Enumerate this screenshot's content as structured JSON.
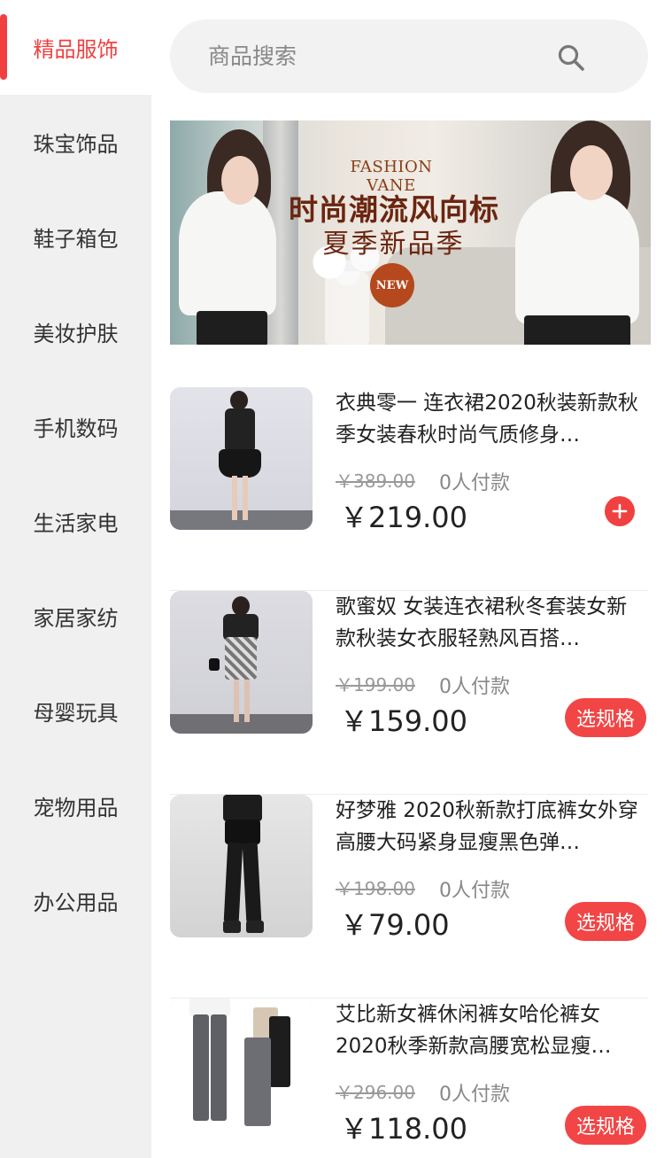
{
  "sidebar": {
    "categories": [
      {
        "label": "精品服饰",
        "active": true
      },
      {
        "label": "珠宝饰品",
        "active": false
      },
      {
        "label": "鞋子箱包",
        "active": false
      },
      {
        "label": "美妆护肤",
        "active": false
      },
      {
        "label": "手机数码",
        "active": false
      },
      {
        "label": "生活家电",
        "active": false
      },
      {
        "label": "家居家纺",
        "active": false
      },
      {
        "label": "母婴玩具",
        "active": false
      },
      {
        "label": "宠物用品",
        "active": false
      },
      {
        "label": "办公用品",
        "active": false
      }
    ],
    "active_color": "#f04040"
  },
  "search": {
    "placeholder": "商品搜索",
    "icon": "search-icon"
  },
  "banner": {
    "brand": "FASHION VANE",
    "headline": "时尚潮流风向标",
    "subtitle": "夏季新品季",
    "badge": "NEW"
  },
  "products": [
    {
      "title": "衣典零一 连衣裙2020秋装新款秋季女装春秋时尚气质修身…",
      "original_price": "￥389.00",
      "paid_count": "0人付款",
      "price": "￥219.00",
      "action": "add",
      "action_icon": "plus-icon"
    },
    {
      "title": "歌蜜奴 女装连衣裙秋冬套装女新款秋装女衣服轻熟风百搭…",
      "original_price": "￥199.00",
      "paid_count": "0人付款",
      "price": "￥159.00",
      "action": "spec",
      "action_label": "选规格"
    },
    {
      "title": "好梦雅 2020秋新款打底裤女外穿高腰大码紧身显瘦黑色弹…",
      "original_price": "￥198.00",
      "paid_count": "0人付款",
      "price": "￥79.00",
      "action": "spec",
      "action_label": "选规格"
    },
    {
      "title": "艾比新女裤休闲裤女哈伦裤女2020秋季新款高腰宽松显瘦…",
      "original_price": "￥296.00",
      "paid_count": "0人付款",
      "price": "￥118.00",
      "action": "spec",
      "action_label": "选规格"
    }
  ]
}
